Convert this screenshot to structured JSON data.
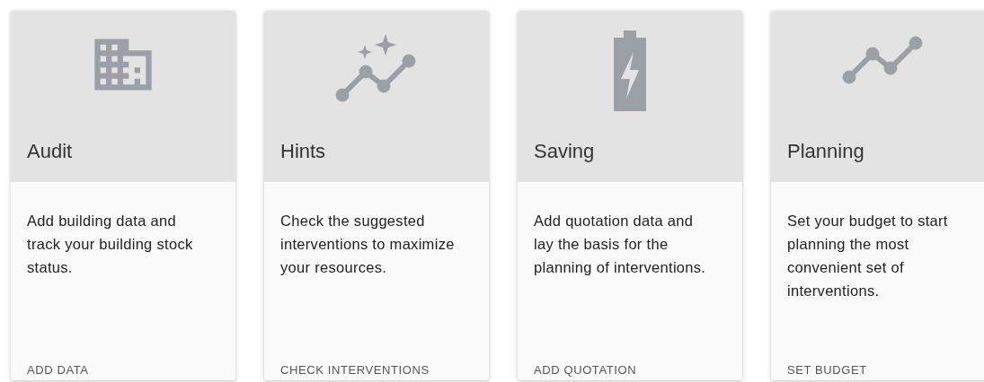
{
  "cards": [
    {
      "title": "Audit",
      "description": "Add building data and track your building stock status.",
      "action": "ADD DATA"
    },
    {
      "title": "Hints",
      "description": "Check the suggested interventions to maximize your resources.",
      "action": "CHECK INTERVENTIONS"
    },
    {
      "title": "Saving",
      "description": "Add quotation data and lay the basis for the planning of interventions.",
      "action": "ADD QUOTATION"
    },
    {
      "title": "Planning",
      "description": "Set your budget to start planning the most convenient set of interventions.",
      "action": "SET BUDGET"
    }
  ]
}
